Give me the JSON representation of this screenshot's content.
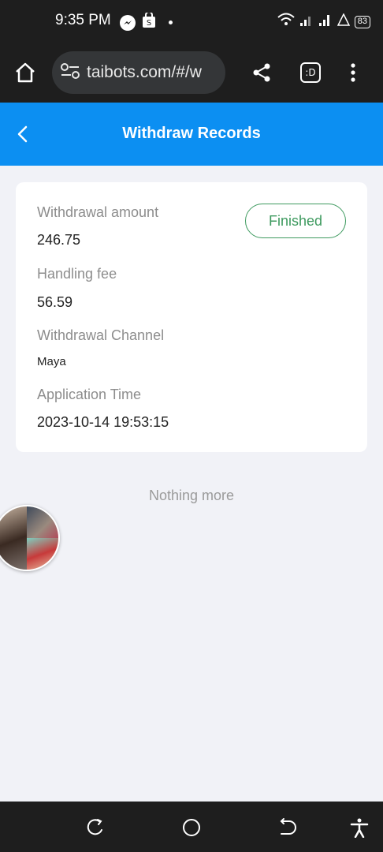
{
  "status_bar": {
    "time": "9:35 PM",
    "battery": "83",
    "icons": [
      "messenger-icon",
      "shop-icon",
      "wifi-icon",
      "signal-icon",
      "signal-icon",
      "alert-icon",
      "battery-icon"
    ]
  },
  "browser": {
    "url": "taibots.com/#/w",
    "tab_label": ":D"
  },
  "header": {
    "title": "Withdraw Records",
    "color": "#0c8ff2"
  },
  "record": {
    "status": "Finished",
    "status_color": "#3e9a5f",
    "fields": [
      {
        "label": "Withdrawal amount",
        "value": "246.75"
      },
      {
        "label": "Handling fee",
        "value": "56.59"
      },
      {
        "label": "Withdrawal Channel",
        "value": "Maya"
      },
      {
        "label": "Application Time",
        "value": "2023-10-14 19:53:15"
      }
    ]
  },
  "footer_text": "Nothing more",
  "nav": {
    "icons": [
      "recents-icon",
      "home-circle-icon",
      "back-icon",
      "accessibility-icon"
    ]
  }
}
